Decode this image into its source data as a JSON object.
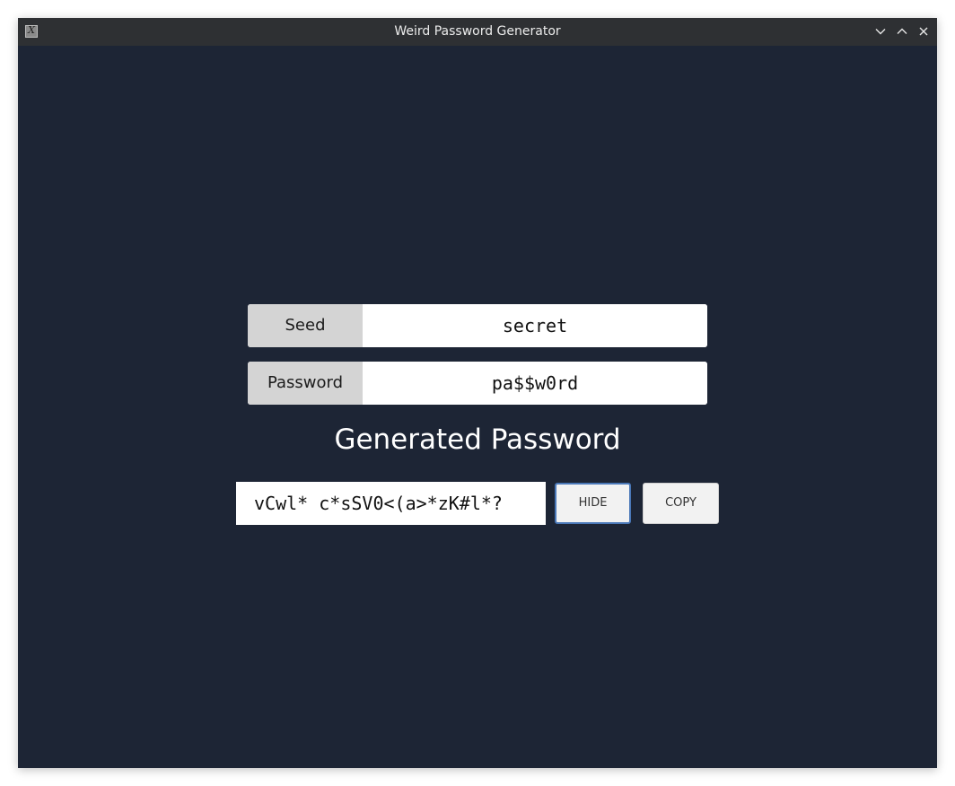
{
  "window": {
    "title": "Weird Password Generator"
  },
  "form": {
    "seed": {
      "label": "Seed",
      "value": "secret"
    },
    "password": {
      "label": "Password",
      "value": "pa$$w0rd"
    }
  },
  "generated": {
    "heading": "Generated Password",
    "value": "vCwl* c*sSV0<(a>*zK#l*?",
    "hide_label": "HIDE",
    "copy_label": "COPY"
  }
}
